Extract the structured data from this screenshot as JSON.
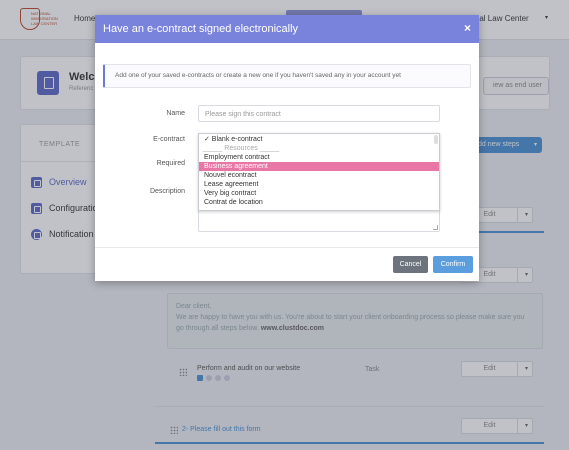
{
  "app": {
    "logo_text": "NATIONAL\nIMMIGRATION\nLAW CENTER",
    "nav_home": "Home",
    "user_name": "ational Law Center",
    "user_caret": "▾"
  },
  "welcome": {
    "title": "Welco",
    "subtitle": "Referenc",
    "view_end_user": "iew as end user"
  },
  "sidebar": {
    "heading": "TEMPLATE",
    "items": [
      {
        "label": "Overview",
        "active": true
      },
      {
        "label": "Configuratio",
        "active": false
      },
      {
        "label": "Notification",
        "active": false
      }
    ]
  },
  "steps": {
    "add_label": "dd new steps",
    "edit_label": "Edit",
    "message_lines": [
      "Dear client,",
      "We are happy to have you with us. You're about to start your client onboarding process so please make sure you",
      "go through all steps below."
    ],
    "message_site": "www.clustdoc.com",
    "task_title": "Perform and audit on our website",
    "task_type": "Task",
    "step2_title": "2- Please fill out this form"
  },
  "modal": {
    "title": "Have an e-contract signed electronically",
    "close": "×",
    "info": "Add one of your saved e-contracts or create a new one if you haven't saved any in your account yet",
    "name_label": "Name",
    "name_placeholder": "Please sign this contract",
    "econtract_label": "E-contract",
    "required_label": "Required",
    "description_label": "Description",
    "dropdown_options": [
      {
        "label": "✓ Blank e-contract",
        "type": "option"
      },
      {
        "label": "_____ Resources _____",
        "type": "group"
      },
      {
        "label": "Employment contract",
        "type": "option"
      },
      {
        "label": "Business agreement",
        "type": "selected"
      },
      {
        "label": "Nouvel econtract",
        "type": "option"
      },
      {
        "label": "Lease agreement",
        "type": "option"
      },
      {
        "label": "Very big contract",
        "type": "option"
      },
      {
        "label": "Contrat de location",
        "type": "option"
      }
    ],
    "cancel_label": "Cancel",
    "confirm_label": "Confirm"
  },
  "colors": {
    "header": "#7a83dc",
    "accent": "#5b67c9",
    "selection": "#e877a6",
    "confirm": "#5a9ede",
    "cancel": "#6d747e"
  }
}
